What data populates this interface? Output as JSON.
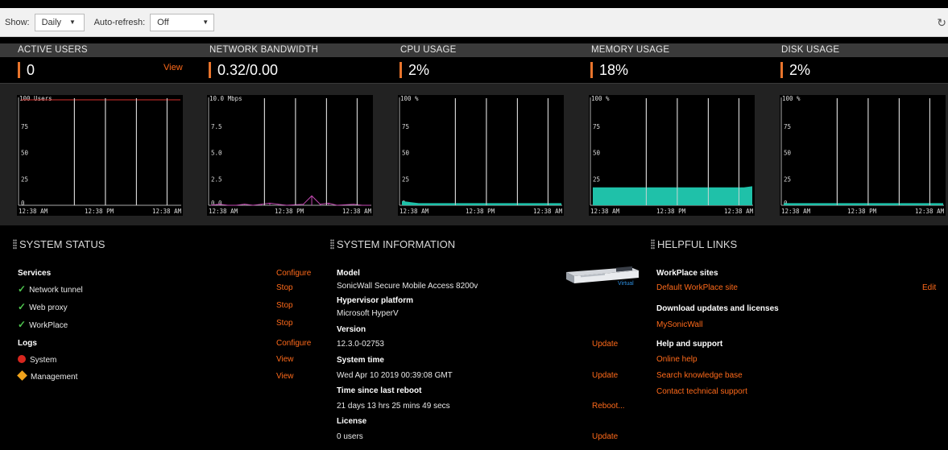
{
  "toolbar": {
    "show_label": "Show:",
    "show_value": "Daily",
    "autorefresh_label": "Auto-refresh:",
    "autorefresh_value": "Off",
    "refresh_icon": "refresh-icon"
  },
  "metrics": [
    {
      "title": "ACTIVE USERS",
      "value": "0",
      "link": "View"
    },
    {
      "title": "NETWORK BANDWIDTH",
      "value": "0.32/0.00"
    },
    {
      "title": "CPU USAGE",
      "value": "2%"
    },
    {
      "title": "MEMORY USAGE",
      "value": "18%"
    },
    {
      "title": "DISK USAGE",
      "value": "2%"
    }
  ],
  "colors": {
    "accent": "#ff6a1a",
    "fill": "#1fc1a9",
    "users_line": "#d9302c",
    "bw_line": "#c64ab5"
  },
  "chart_data": [
    {
      "type": "area",
      "title": "100 Users",
      "yticks": [
        "75",
        "50",
        "25",
        "0"
      ],
      "xticks": [
        "12:38 AM",
        "12:38 PM",
        "12:38 AM"
      ],
      "ylim": [
        0,
        100
      ],
      "series": [
        {
          "values": [
            100,
            100,
            100,
            100,
            100,
            100,
            100,
            100,
            100,
            100
          ]
        }
      ]
    },
    {
      "type": "line",
      "title": "10.0 Mbps",
      "yticks": [
        "7.5",
        "5.0",
        "2.5",
        "0.0"
      ],
      "xticks": [
        "12:38 AM",
        "12:38 PM",
        "12:38 AM"
      ],
      "ylim": [
        0,
        10
      ],
      "series": [
        {
          "values": [
            0,
            0.1,
            0,
            0,
            0.1,
            0,
            0.1,
            0.2,
            0.1,
            0,
            0.05,
            0.1,
            0.9,
            0.1,
            0.2,
            0,
            0.05,
            0.1,
            0,
            0
          ]
        }
      ]
    },
    {
      "type": "area",
      "title": "100 %",
      "yticks": [
        "75",
        "50",
        "25",
        "0"
      ],
      "xticks": [
        "12:38 AM",
        "12:38 PM",
        "12:38 AM"
      ],
      "ylim": [
        0,
        100
      ],
      "series": [
        {
          "values": [
            4,
            3,
            2,
            2,
            2,
            2,
            2,
            2,
            2,
            2,
            2,
            2,
            2,
            2,
            2,
            2,
            2,
            2,
            2,
            2
          ]
        }
      ]
    },
    {
      "type": "area",
      "title": "100 %",
      "yticks": [
        "75",
        "50",
        "25",
        "0"
      ],
      "xticks": [
        "12:38 AM",
        "12:38 PM",
        "12:38 AM"
      ],
      "ylim": [
        0,
        100
      ],
      "series": [
        {
          "values": [
            17,
            17,
            17,
            17,
            17,
            17,
            17,
            17,
            17,
            17,
            17,
            17,
            17,
            17,
            17,
            17,
            17,
            17,
            17,
            18
          ]
        }
      ]
    },
    {
      "type": "area",
      "title": "100 %",
      "yticks": [
        "75",
        "50",
        "25",
        "0"
      ],
      "xticks": [
        "12:38 AM",
        "12:38 PM",
        "12:38 AM"
      ],
      "ylim": [
        0,
        100
      ],
      "series": [
        {
          "values": [
            2,
            2,
            2,
            2,
            2,
            2,
            2,
            2,
            2,
            2,
            2,
            2,
            2,
            2,
            2,
            2,
            2,
            2,
            2,
            2
          ]
        }
      ]
    }
  ],
  "system_status": {
    "title": "SYSTEM STATUS",
    "services_label": "Services",
    "services_action": "Configure",
    "services": [
      {
        "name": "Network tunnel",
        "action": "Stop"
      },
      {
        "name": "Web proxy",
        "action": "Stop"
      },
      {
        "name": "WorkPlace",
        "action": "Stop"
      }
    ],
    "logs_label": "Logs",
    "logs_action": "Configure",
    "logs": [
      {
        "name": "System",
        "action": "View"
      },
      {
        "name": "Management",
        "action": "View"
      }
    ]
  },
  "system_info": {
    "title": "SYSTEM INFORMATION",
    "model_label": "Model",
    "model_value": "SonicWall Secure Mobile Access 8200v",
    "device_label": "Virtual",
    "hypervisor_label": "Hypervisor platform",
    "hypervisor_value": "Microsoft HyperV",
    "version_label": "Version",
    "version_value": "12.3.0-02753",
    "version_action": "Update",
    "time_label": "System time",
    "time_value": "Wed Apr 10 2019 00:39:08 GMT",
    "time_action": "Update",
    "reboot_label": "Time since last reboot",
    "reboot_value": "21 days 13 hrs 25 mins 49 secs",
    "reboot_action": "Reboot...",
    "license_label": "License",
    "license_value": "0 users",
    "license_action": "Update"
  },
  "helpful_links": {
    "title": "HELPFUL LINKS",
    "workplace_label": "WorkPlace sites",
    "workplace_link": "Default WorkPlace site",
    "workplace_action": "Edit",
    "download_label": "Download updates and licenses",
    "download_link": "MySonicWall",
    "help_label": "Help and support",
    "help_links": [
      "Online help",
      "Search knowledge base",
      "Contact technical support"
    ]
  }
}
